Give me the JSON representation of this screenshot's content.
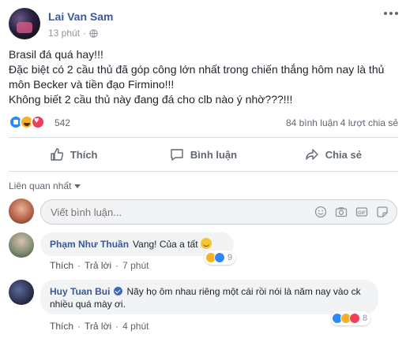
{
  "post": {
    "author": "Lai Van Sam",
    "time": "13 phút",
    "time_separator": "·",
    "text_lines": [
      "Brasil đá quá hay!!!",
      "Đặc biệt có 2 cầu thủ đã góp công lớn nhất trong chiến thắng hôm nay là thủ môn Becker và tiền đạo Firmino!!!",
      "Không biết 2 cầu thủ này đang đá cho clb nào ý nhờ???!!!"
    ],
    "reaction_count": "542",
    "comment_count": "84 bình luận",
    "share_count": "4 lượt chia sẻ"
  },
  "actions": {
    "like": "Thích",
    "comment": "Bình luận",
    "share": "Chia sẻ"
  },
  "sort_label": "Liên quan nhất",
  "compose": {
    "placeholder": "Viết bình luận..."
  },
  "comments": [
    {
      "name": "Phạm Như Thuần",
      "text": "Vang! Của a tất",
      "like_label": "Thích",
      "reply_label": "Trả lời",
      "time": "7 phút",
      "reactions": "9"
    },
    {
      "name": "Huy Tuan Bui",
      "text": "Nãy họ ôm nhau riêng một cái rồi nói là năm nay vào ck nhiều quá mày ơi.",
      "like_label": "Thích",
      "reply_label": "Trả lời",
      "time": "4 phút",
      "reactions": "8"
    }
  ],
  "colors": {
    "link_blue": "#385898",
    "muted": "#606770",
    "bubble": "#f2f3f5",
    "like_blue": "#2d88ff",
    "love_red": "#f33e58",
    "haha_yellow": "#f7b125"
  }
}
